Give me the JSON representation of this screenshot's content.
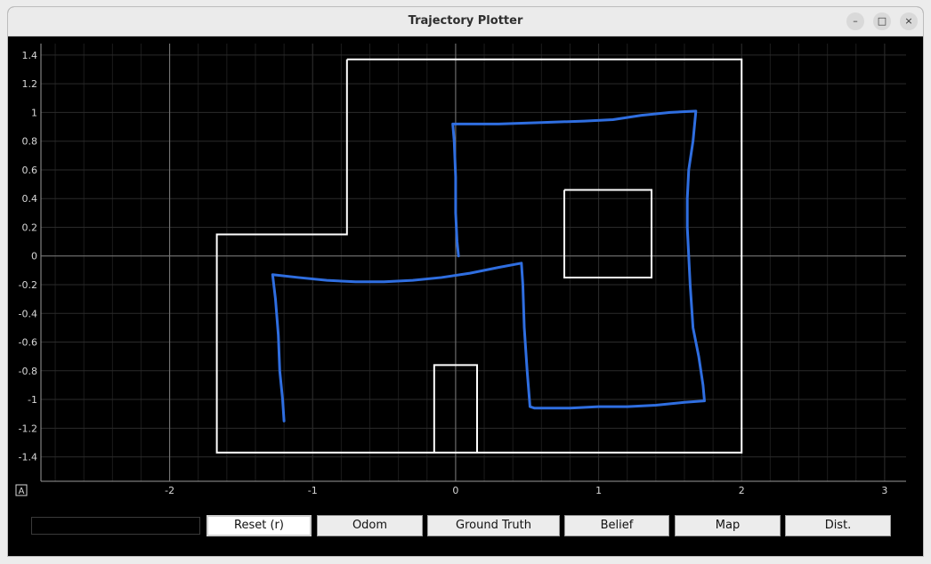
{
  "window": {
    "title": "Trajectory Plotter"
  },
  "window_controls": {
    "minimize": "–",
    "maximize": "□",
    "close": "×"
  },
  "colors": {
    "background": "#000000",
    "grid": "#2b2b2b",
    "axis": "#7a7a7a",
    "map": "#ffffff",
    "trajectory": "#2f6ee0"
  },
  "chart_data": {
    "type": "line",
    "xlim": [
      -2.9,
      3.15
    ],
    "ylim": [
      -1.57,
      1.48
    ],
    "x_ticks": [
      -2,
      -1,
      0,
      1,
      2,
      3
    ],
    "y_ticks": [
      -1.4,
      -1.2,
      -1,
      -0.8,
      -0.6,
      -0.4,
      -0.2,
      0,
      0.2,
      0.4,
      0.6,
      0.8,
      1,
      1.2,
      1.4
    ],
    "grid": true,
    "auto_range_label": "A",
    "map_segments": [
      {
        "name": "outer-wall",
        "points": [
          [
            -0.76,
            1.37
          ],
          [
            2.0,
            1.37
          ],
          [
            2.0,
            -1.37
          ],
          [
            -1.67,
            -1.37
          ],
          [
            -1.67,
            0.15
          ],
          [
            -0.76,
            0.15
          ],
          [
            -0.76,
            1.37
          ]
        ]
      },
      {
        "name": "inner-box",
        "points": [
          [
            0.76,
            0.46
          ],
          [
            1.37,
            0.46
          ],
          [
            1.37,
            -0.15
          ],
          [
            0.76,
            -0.15
          ],
          [
            0.76,
            0.46
          ]
        ]
      },
      {
        "name": "bottom-box",
        "points": [
          [
            -0.15,
            -1.37
          ],
          [
            -0.15,
            -0.76
          ],
          [
            0.15,
            -0.76
          ],
          [
            0.15,
            -1.37
          ]
        ]
      }
    ],
    "series": [
      {
        "points": [
          [
            0.02,
            0.0
          ],
          [
            0.01,
            0.1
          ],
          [
            0.0,
            0.3
          ],
          [
            0.0,
            0.55
          ],
          [
            -0.01,
            0.8
          ],
          [
            -0.02,
            0.92
          ],
          [
            0.05,
            0.92
          ],
          [
            0.3,
            0.92
          ],
          [
            0.6,
            0.93
          ],
          [
            0.9,
            0.94
          ],
          [
            1.1,
            0.95
          ],
          [
            1.3,
            0.98
          ],
          [
            1.5,
            1.0
          ],
          [
            1.68,
            1.01
          ],
          [
            1.66,
            0.8
          ],
          [
            1.63,
            0.6
          ],
          [
            1.62,
            0.4
          ],
          [
            1.62,
            0.2
          ],
          [
            1.63,
            0.0
          ],
          [
            1.64,
            -0.2
          ],
          [
            1.66,
            -0.5
          ],
          [
            1.7,
            -0.7
          ],
          [
            1.73,
            -0.9
          ],
          [
            1.74,
            -1.01
          ],
          [
            1.6,
            -1.02
          ],
          [
            1.4,
            -1.04
          ],
          [
            1.2,
            -1.05
          ],
          [
            1.0,
            -1.05
          ],
          [
            0.8,
            -1.06
          ],
          [
            0.55,
            -1.06
          ],
          [
            0.52,
            -1.05
          ],
          [
            0.5,
            -0.8
          ],
          [
            0.48,
            -0.5
          ],
          [
            0.47,
            -0.2
          ],
          [
            0.46,
            -0.05
          ],
          [
            0.3,
            -0.08
          ],
          [
            0.1,
            -0.12
          ],
          [
            -0.1,
            -0.15
          ],
          [
            -0.3,
            -0.17
          ],
          [
            -0.5,
            -0.18
          ],
          [
            -0.7,
            -0.18
          ],
          [
            -0.9,
            -0.17
          ],
          [
            -1.1,
            -0.15
          ],
          [
            -1.28,
            -0.13
          ],
          [
            -1.26,
            -0.3
          ],
          [
            -1.24,
            -0.55
          ],
          [
            -1.23,
            -0.8
          ],
          [
            -1.21,
            -1.0
          ],
          [
            -1.2,
            -1.15
          ]
        ]
      }
    ]
  },
  "footer": {
    "input_value": "",
    "buttons": [
      "Reset (r)",
      "Odom",
      "Ground Truth",
      "Belief",
      "Map",
      "Dist."
    ]
  }
}
